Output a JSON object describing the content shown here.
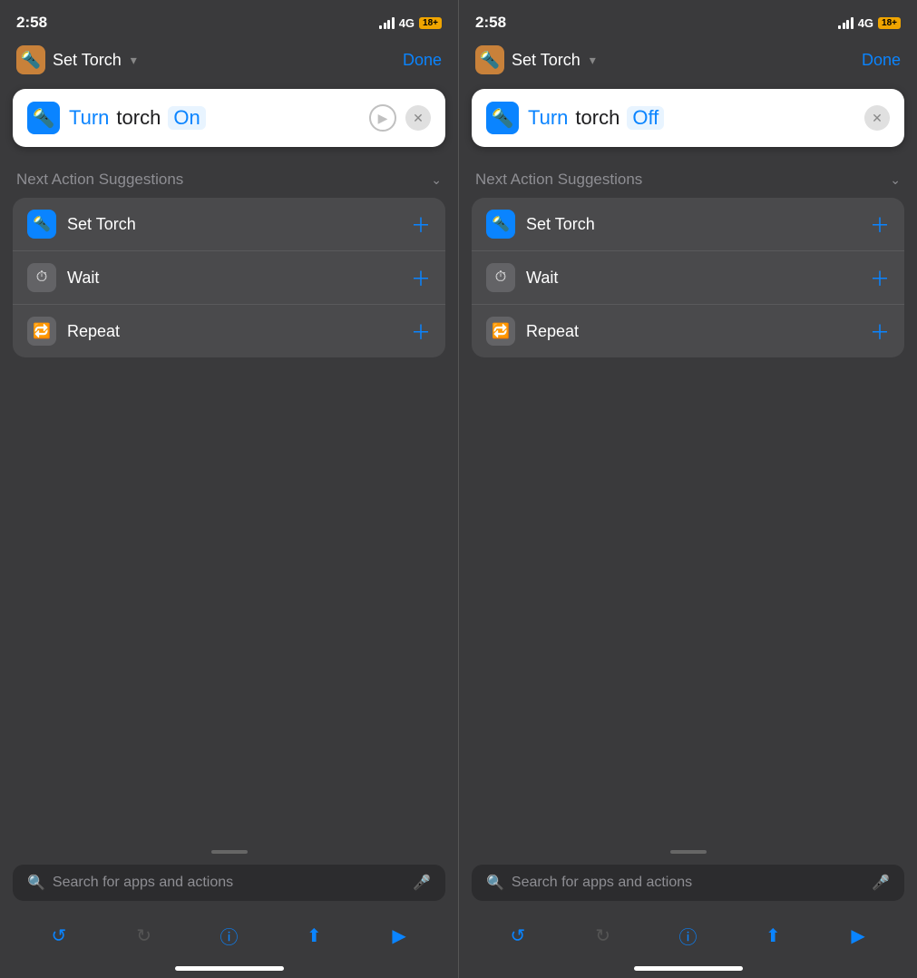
{
  "left": {
    "statusBar": {
      "time": "2:58",
      "signal": "4G",
      "battery": "18+"
    },
    "nav": {
      "title": "Set Torch",
      "chevron": "▾",
      "done": "Done"
    },
    "actionCard": {
      "turnLabel": "Turn",
      "torchLabel": "torch",
      "stateLabel": "On"
    },
    "suggestions": {
      "title": "Next Action Suggestions",
      "items": [
        {
          "label": "Set Torch",
          "iconType": "torch"
        },
        {
          "label": "Wait",
          "iconType": "wait"
        },
        {
          "label": "Repeat",
          "iconType": "repeat"
        }
      ]
    },
    "search": {
      "placeholder": "Search for apps and actions"
    }
  },
  "right": {
    "statusBar": {
      "time": "2:58",
      "signal": "4G",
      "battery": "18+"
    },
    "nav": {
      "title": "Set Torch",
      "chevron": "▾",
      "done": "Done"
    },
    "actionCard": {
      "turnLabel": "Turn",
      "torchLabel": "torch",
      "stateLabel": "Off"
    },
    "suggestions": {
      "title": "Next Action Suggestions",
      "items": [
        {
          "label": "Set Torch",
          "iconType": "torch"
        },
        {
          "label": "Wait",
          "iconType": "wait"
        },
        {
          "label": "Repeat",
          "iconType": "repeat"
        }
      ]
    },
    "search": {
      "placeholder": "Search for apps and actions"
    }
  }
}
